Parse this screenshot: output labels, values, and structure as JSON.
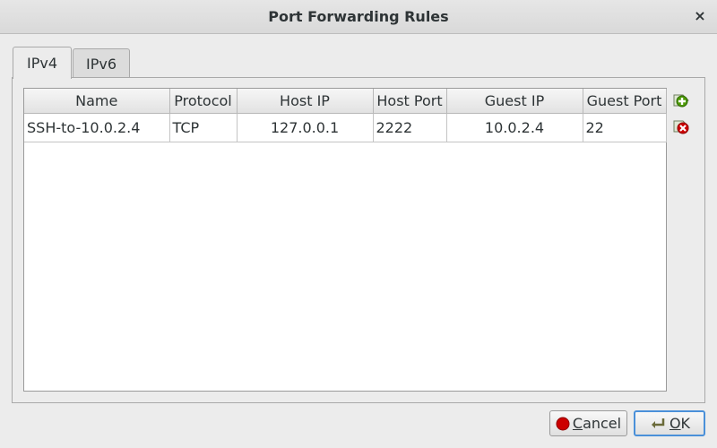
{
  "window": {
    "title": "Port Forwarding Rules",
    "close_glyph": "×"
  },
  "tabs": [
    {
      "label": "IPv4",
      "active": true
    },
    {
      "label": "IPv6",
      "active": false
    }
  ],
  "table": {
    "columns": [
      "Name",
      "Protocol",
      "Host IP",
      "Host Port",
      "Guest IP",
      "Guest Port"
    ],
    "rows": [
      {
        "name": "SSH-to-10.0.2.4",
        "protocol": "TCP",
        "host_ip": "127.0.0.1",
        "host_port": "2222",
        "guest_ip": "10.0.2.4",
        "guest_port": "22"
      }
    ]
  },
  "side_buttons": {
    "add_icon": "add-rule-icon",
    "remove_icon": "remove-rule-icon"
  },
  "buttons": {
    "cancel": {
      "mnemonic": "C",
      "rest": "ancel"
    },
    "ok": {
      "mnemonic": "O",
      "rest": "K"
    }
  },
  "colors": {
    "add_green": "#4e9a06",
    "remove_red": "#cc0000",
    "ok_focus": "#4a90d9"
  }
}
